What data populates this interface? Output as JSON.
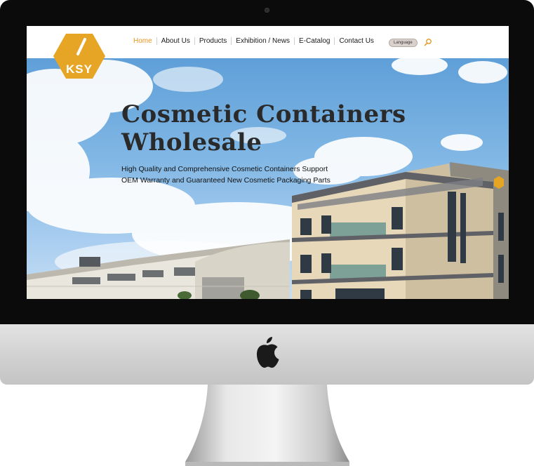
{
  "brand": {
    "logo_text": "KSY",
    "color": "#e7a526"
  },
  "nav": {
    "items": [
      {
        "label": "Home",
        "active": true
      },
      {
        "label": "About Us"
      },
      {
        "label": "Products"
      },
      {
        "label": "Exhibition / News"
      },
      {
        "label": "E-Catalog"
      },
      {
        "label": "Contact Us"
      }
    ],
    "language_label": "Language",
    "search_icon": "search-icon",
    "active_color": "#e7941c"
  },
  "hero": {
    "title_line1": "Cosmetic Containers",
    "title_line2": "Wholesale",
    "subtitle_line1": "High Quality and Comprehensive Cosmetic Containers Support",
    "subtitle_line2": "OEM Warranty and Guaranteed New Cosmetic Packaging Parts"
  },
  "device": {
    "logo_icon": "apple-logo-icon"
  }
}
